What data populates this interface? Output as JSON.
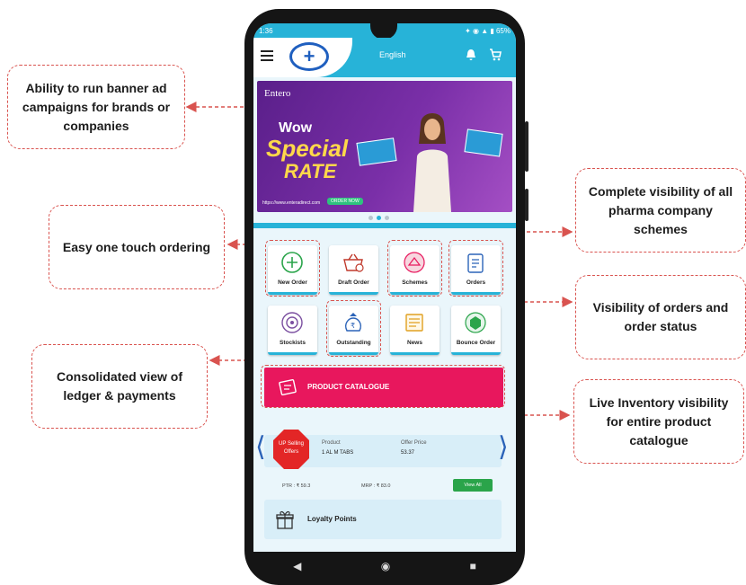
{
  "callouts": {
    "banner": "Ability to run banner ad campaigns for brands or companies",
    "one_touch": "Easy one touch ordering",
    "schemes": "Complete visibility of all pharma company schemes",
    "orders": "Visibility of orders and order status",
    "ledger": "Consolidated view of ledger & payments",
    "inventory": "Live Inventory visibility for entire product catalogue"
  },
  "status_bar": {
    "time": "1:36",
    "battery": "65%"
  },
  "app_bar": {
    "language": "English"
  },
  "banner": {
    "brand": "Entero",
    "line1": "Wow",
    "line2": "Special",
    "line3": "RATE",
    "url": "https://www.enteradirect.com",
    "cta": "ORDER NOW"
  },
  "tiles": {
    "new_order": "New Order",
    "draft_order": "Draft Order",
    "schemes": "Schemes",
    "orders": "Orders",
    "stockists": "Stockists",
    "outstanding": "Outstanding",
    "news": "News",
    "bounce_order": "Bounce Order"
  },
  "catalogue": {
    "label": "PRODUCT CATALOGUE"
  },
  "upsell": {
    "badge": "UP Selling Offers",
    "product_label": "Product",
    "product_value": "1 AL M TABS",
    "offer_label": "Offer Price",
    "offer_value": "53.37",
    "ptr": "PTR : ₹ 59.3",
    "mrp": "MRP : ₹ 83.0",
    "view_all": "View All"
  },
  "loyalty": {
    "label": "Loyalty Points"
  },
  "colors": {
    "accent": "#27b3d8",
    "catalogue": "#e8175d",
    "callout_border": "#d9534f",
    "view_all": "#2aa44a"
  },
  "icons": [
    "menu-icon",
    "bell-icon",
    "cart-icon",
    "plus-circle-icon",
    "basket-icon",
    "scheme-icon",
    "clipboard-icon",
    "target-icon",
    "money-bag-icon",
    "news-icon",
    "bounce-icon",
    "catalogue-icon",
    "gift-icon",
    "back-icon",
    "home-icon",
    "recents-icon"
  ]
}
